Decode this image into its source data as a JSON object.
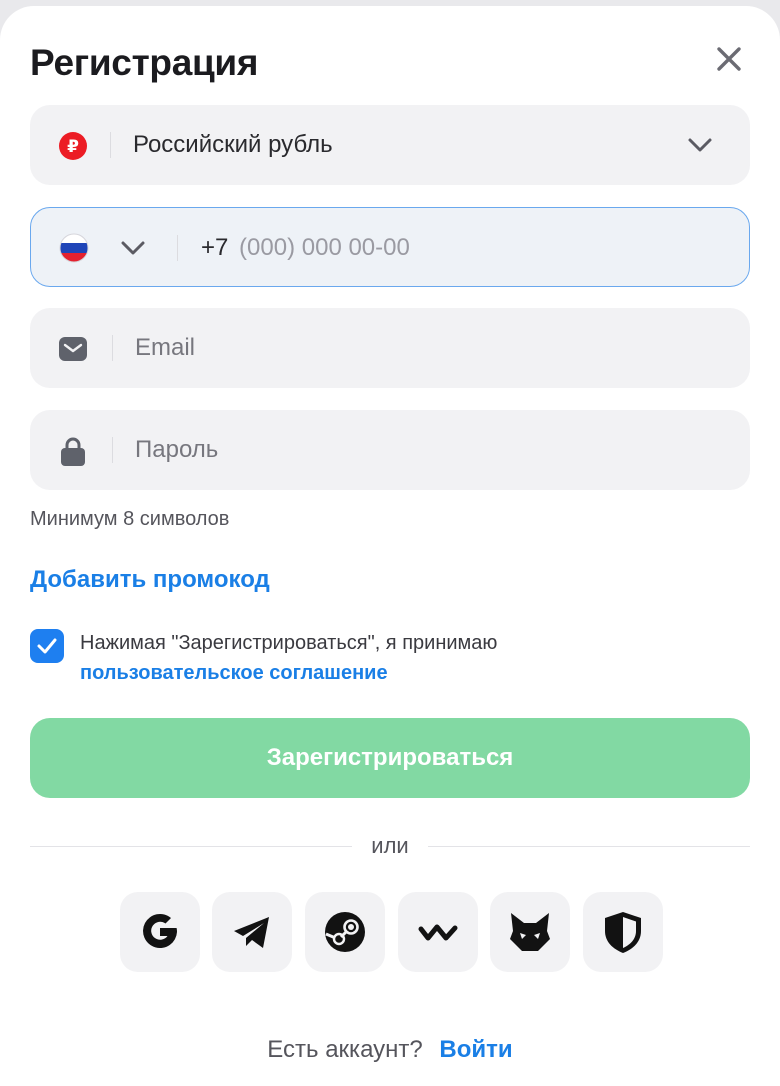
{
  "header": {
    "title": "Регистрация"
  },
  "currency": {
    "selected": "Российский рубль",
    "symbol": "₽"
  },
  "phone": {
    "prefix": "+7",
    "placeholder": "(000) 000 00-00"
  },
  "email": {
    "placeholder": "Email"
  },
  "password": {
    "placeholder": "Пароль",
    "hint": "Минимум 8 символов"
  },
  "promo": {
    "label": "Добавить промокод"
  },
  "agreement": {
    "checked": true,
    "text": "Нажимая \"Зарегистрироваться\", я принимаю",
    "link": "пользовательское соглашение"
  },
  "submit": {
    "label": "Зарегистрироваться"
  },
  "divider": {
    "label": "или"
  },
  "social": [
    "google-icon",
    "telegram-icon",
    "steam-icon",
    "walletconnect-icon",
    "metamask-fox-icon",
    "shield-icon"
  ],
  "footer": {
    "question": "Есть аккаунт?",
    "login": "Войти"
  },
  "colors": {
    "accent": "#1a7fe6",
    "submit": "#82d9a3",
    "ruble": "#ec1c24"
  }
}
